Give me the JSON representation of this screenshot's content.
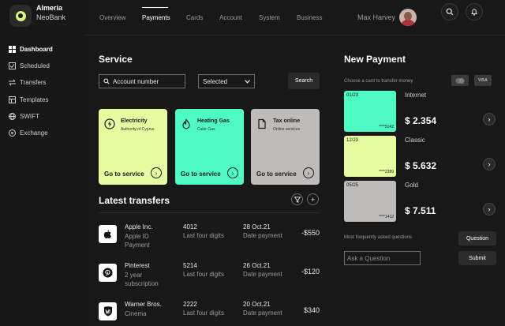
{
  "brand": {
    "name": "Almeria",
    "sub": "NeoBank"
  },
  "sidebar": {
    "items": [
      {
        "label": "Dashboard",
        "icon": "dashboard-icon"
      },
      {
        "label": "Scheduled",
        "icon": "calendar-check-icon"
      },
      {
        "label": "Transfers",
        "icon": "transfer-icon"
      },
      {
        "label": "Templates",
        "icon": "templates-icon"
      },
      {
        "label": "SWIFT",
        "icon": "globe-icon"
      },
      {
        "label": "Exchange",
        "icon": "exchange-icon"
      }
    ]
  },
  "topnav": {
    "tabs": [
      "Overview",
      "Payments",
      "Cards",
      "Account",
      "System",
      "Business"
    ],
    "active": "Payments",
    "user": "Max Harvey"
  },
  "service": {
    "title": "Service",
    "search_placeholder": "Account number",
    "select_value": "Selected",
    "search_button": "Search",
    "cards": [
      {
        "title": "Electricity",
        "sub": "Authority of Cyprus",
        "cta": "Go to service",
        "color": "#e7fca0",
        "icon": "lightning-icon"
      },
      {
        "title": "Heating Gas",
        "sub": "Calor Gas",
        "cta": "Go to service",
        "color": "#4dfbc3",
        "icon": "flame-icon"
      },
      {
        "title": "Tax online",
        "sub": "Online services",
        "cta": "Go to service",
        "color": "#bdbcba",
        "icon": "document-icon"
      }
    ]
  },
  "transfers": {
    "title": "Latest transfers",
    "rows": [
      {
        "name": "Apple Inc.",
        "desc": "Apple ID Payment",
        "num": "4012",
        "num_label": "Last four digits",
        "date": "28 Oct.21",
        "date_label": "Date payment",
        "amount": "-$550",
        "icon": "apple-icon"
      },
      {
        "name": "Pinterest",
        "desc": "2 year subscription",
        "num": "5214",
        "num_label": "Last four digits",
        "date": "26 Oct.21",
        "date_label": "Date payment",
        "amount": "-$120",
        "icon": "pinterest-icon"
      },
      {
        "name": "Warner Bros.",
        "desc": "Cinema",
        "num": "2222",
        "num_label": "Last four digits",
        "date": "20 Oct.21",
        "date_label": "Date payment",
        "amount": "$340",
        "icon": "warner-bros-icon"
      }
    ]
  },
  "new_payment": {
    "title": "New Payment",
    "subtitle": "Choose a card to transfer money",
    "card_brands": [
      "mastercard-icon",
      "visa-icon"
    ],
    "visa_text": "VISA",
    "cards": [
      {
        "exp": "01/23",
        "last": "****5142",
        "color": "#4dfbc3",
        "account": "Internet",
        "amount": "$ 2.354"
      },
      {
        "exp": "12/23",
        "last": "****2389",
        "color": "#e7fca0",
        "account": "Classic",
        "amount": "$ 5.632"
      },
      {
        "exp": "05/25",
        "last": "****1412",
        "color": "#bdbcba",
        "account": "Gold",
        "amount": "$ 7.511"
      }
    ],
    "faq_text": "Most frequently asked questions",
    "question_button": "Question",
    "ask_placeholder": "Ask a Question",
    "submit_button": "Submit"
  }
}
